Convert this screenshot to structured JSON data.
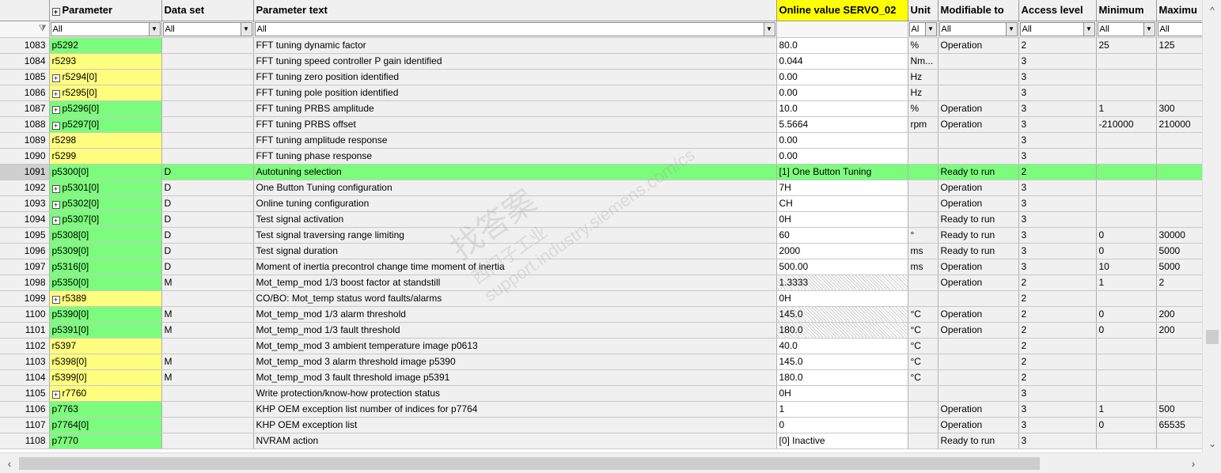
{
  "columns": {
    "parameter": "Parameter",
    "data_set": "Data set",
    "parameter_text": "Parameter text",
    "online_value": "Online value SERVO_02",
    "unit": "Unit",
    "modifiable_to": "Modifiable to",
    "access_level": "Access level",
    "minimum": "Minimum",
    "maximum": "Maximu"
  },
  "filters": {
    "parameter": "All",
    "data_set": "All",
    "parameter_text": "All",
    "unit": "Al",
    "modifiable_to": "All",
    "access_level": "All",
    "minimum": "All",
    "maximum": "All"
  },
  "watermark": {
    "line1": "西门子工业",
    "line2": "找答案",
    "line3": "support.industry.siemens.com/cs"
  },
  "colors": {
    "editable": "#7cfc7c",
    "readonly": "#ffff7f",
    "header_highlight": "#ffff00"
  },
  "rows": [
    {
      "num": "1083",
      "param": "p5292",
      "expand": false,
      "kind": "green",
      "ds": "",
      "text": "FFT tuning dynamic factor",
      "value": "80.0",
      "unit": "%",
      "mod": "Operation",
      "access": "2",
      "min": "25",
      "max": "125"
    },
    {
      "num": "1084",
      "param": "r5293",
      "expand": false,
      "kind": "yellow",
      "ds": "",
      "text": "FFT tuning speed controller P gain identified",
      "value": "0.044",
      "unit": "Nm...",
      "mod": "",
      "access": "3",
      "min": "",
      "max": ""
    },
    {
      "num": "1085",
      "param": "r5294[0]",
      "expand": true,
      "kind": "yellow",
      "ds": "",
      "text": "FFT tuning zero position identified",
      "value": "0.00",
      "unit": "Hz",
      "mod": "",
      "access": "3",
      "min": "",
      "max": ""
    },
    {
      "num": "1086",
      "param": "r5295[0]",
      "expand": true,
      "kind": "yellow",
      "ds": "",
      "text": "FFT tuning pole position identified",
      "value": "0.00",
      "unit": "Hz",
      "mod": "",
      "access": "3",
      "min": "",
      "max": ""
    },
    {
      "num": "1087",
      "param": "p5296[0]",
      "expand": true,
      "kind": "green",
      "ds": "",
      "text": "FFT tuning PRBS amplitude",
      "value": "10.0",
      "unit": "%",
      "mod": "Operation",
      "access": "3",
      "min": "1",
      "max": "300"
    },
    {
      "num": "1088",
      "param": "p5297[0]",
      "expand": true,
      "kind": "green",
      "ds": "",
      "text": "FFT tuning PRBS offset",
      "value": "5.5664",
      "unit": "rpm",
      "mod": "Operation",
      "access": "3",
      "min": "-210000",
      "max": "210000"
    },
    {
      "num": "1089",
      "param": "r5298",
      "expand": false,
      "kind": "yellow",
      "ds": "",
      "text": "FFT tuning amplitude response",
      "value": "0.00",
      "unit": "",
      "mod": "",
      "access": "3",
      "min": "",
      "max": ""
    },
    {
      "num": "1090",
      "param": "r5299",
      "expand": false,
      "kind": "yellow",
      "ds": "",
      "text": "FFT tuning phase response",
      "value": "0.00",
      "unit": "",
      "mod": "",
      "access": "3",
      "min": "",
      "max": ""
    },
    {
      "num": "1091",
      "param": "p5300[0]",
      "expand": false,
      "kind": "green",
      "ds": "D",
      "text": "Autotuning selection",
      "value": "[1] One Button Tuning",
      "unit": "",
      "mod": "Ready to run",
      "access": "2",
      "min": "",
      "max": "",
      "selected": true
    },
    {
      "num": "1092",
      "param": "p5301[0]",
      "expand": true,
      "kind": "green",
      "ds": "D",
      "text": "One Button Tuning configuration",
      "value": "7H",
      "unit": "",
      "mod": "Operation",
      "access": "3",
      "min": "",
      "max": ""
    },
    {
      "num": "1093",
      "param": "p5302[0]",
      "expand": true,
      "kind": "green",
      "ds": "D",
      "text": "Online tuning configuration",
      "value": "CH",
      "unit": "",
      "mod": "Operation",
      "access": "3",
      "min": "",
      "max": ""
    },
    {
      "num": "1094",
      "param": "p5307[0]",
      "expand": true,
      "kind": "green",
      "ds": "D",
      "text": "Test signal activation",
      "value": "0H",
      "unit": "",
      "mod": "Ready to run",
      "access": "3",
      "min": "",
      "max": ""
    },
    {
      "num": "1095",
      "param": "p5308[0]",
      "expand": false,
      "kind": "green",
      "ds": "D",
      "text": "Test signal traversing range limiting",
      "value": "60",
      "unit": "°",
      "mod": "Ready to run",
      "access": "3",
      "min": "0",
      "max": "30000"
    },
    {
      "num": "1096",
      "param": "p5309[0]",
      "expand": false,
      "kind": "green",
      "ds": "D",
      "text": "Test signal duration",
      "value": "2000",
      "unit": "ms",
      "mod": "Ready to run",
      "access": "3",
      "min": "0",
      "max": "5000"
    },
    {
      "num": "1097",
      "param": "p5316[0]",
      "expand": false,
      "kind": "green",
      "ds": "D",
      "text": "Moment of inertia precontrol change time moment of inertia",
      "value": "500.00",
      "unit": "ms",
      "mod": "Operation",
      "access": "3",
      "min": "10",
      "max": "5000"
    },
    {
      "num": "1098",
      "param": "p5350[0]",
      "expand": false,
      "kind": "green",
      "ds": "M",
      "text": "Mot_temp_mod 1/3 boost factor at standstill",
      "value": "1.3333",
      "unit": "",
      "mod": "Operation",
      "access": "2",
      "min": "1",
      "max": "2",
      "hatch": true
    },
    {
      "num": "1099",
      "param": "r5389",
      "expand": true,
      "kind": "yellow",
      "ds": "",
      "text": "CO/BO: Mot_temp status word faults/alarms",
      "value": "0H",
      "unit": "",
      "mod": "",
      "access": "2",
      "min": "",
      "max": ""
    },
    {
      "num": "1100",
      "param": "p5390[0]",
      "expand": false,
      "kind": "green",
      "ds": "M",
      "text": "Mot_temp_mod 1/3 alarm threshold",
      "value": "145.0",
      "unit": "°C",
      "mod": "Operation",
      "access": "2",
      "min": "0",
      "max": "200",
      "hatch": true
    },
    {
      "num": "1101",
      "param": "p5391[0]",
      "expand": false,
      "kind": "green",
      "ds": "M",
      "text": "Mot_temp_mod 1/3 fault threshold",
      "value": "180.0",
      "unit": "°C",
      "mod": "Operation",
      "access": "2",
      "min": "0",
      "max": "200",
      "hatch": true
    },
    {
      "num": "1102",
      "param": "r5397",
      "expand": false,
      "kind": "yellow",
      "ds": "",
      "text": "Mot_temp_mod 3 ambient temperature image p0613",
      "value": "40.0",
      "unit": "°C",
      "mod": "",
      "access": "2",
      "min": "",
      "max": ""
    },
    {
      "num": "1103",
      "param": "r5398[0]",
      "expand": false,
      "kind": "yellow",
      "ds": "M",
      "text": "Mot_temp_mod 3 alarm threshold image p5390",
      "value": "145.0",
      "unit": "°C",
      "mod": "",
      "access": "2",
      "min": "",
      "max": ""
    },
    {
      "num": "1104",
      "param": "r5399[0]",
      "expand": false,
      "kind": "yellow",
      "ds": "M",
      "text": "Mot_temp_mod 3 fault threshold image p5391",
      "value": "180.0",
      "unit": "°C",
      "mod": "",
      "access": "2",
      "min": "",
      "max": ""
    },
    {
      "num": "1105",
      "param": "r7760",
      "expand": true,
      "kind": "yellow",
      "ds": "",
      "text": "Write protection/know-how protection status",
      "value": "0H",
      "unit": "",
      "mod": "",
      "access": "3",
      "min": "",
      "max": ""
    },
    {
      "num": "1106",
      "param": "p7763",
      "expand": false,
      "kind": "green",
      "ds": "",
      "text": "KHP OEM exception list number of indices for p7764",
      "value": "1",
      "unit": "",
      "mod": "Operation",
      "access": "3",
      "min": "1",
      "max": "500"
    },
    {
      "num": "1107",
      "param": "p7764[0]",
      "expand": false,
      "kind": "green",
      "ds": "",
      "text": "KHP OEM exception list",
      "value": "0",
      "unit": "",
      "mod": "Operation",
      "access": "3",
      "min": "0",
      "max": "65535"
    },
    {
      "num": "1108",
      "param": "p7770",
      "expand": false,
      "kind": "green",
      "ds": "",
      "text": "NVRAM action",
      "value": "[0] Inactive",
      "unit": "",
      "mod": "Ready to run",
      "access": "3",
      "min": "",
      "max": ""
    }
  ]
}
